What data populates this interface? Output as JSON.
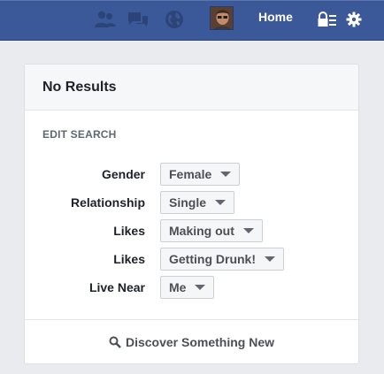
{
  "topbar": {
    "home_label": "Home",
    "icons": [
      "friend-requests-icon",
      "messages-icon",
      "notifications-globe-icon",
      "privacy-shortcuts-icon",
      "settings-gear-icon"
    ]
  },
  "card": {
    "title": "No Results",
    "section_label": "EDIT SEARCH",
    "filters": [
      {
        "label": "Gender",
        "value": "Female"
      },
      {
        "label": "Relationship",
        "value": "Single"
      },
      {
        "label": "Likes",
        "value": "Making out"
      },
      {
        "label": "Likes",
        "value": "Getting Drunk!"
      },
      {
        "label": "Live Near",
        "value": "Me"
      }
    ],
    "footer_link": "Discover Something New"
  },
  "colors": {
    "topbar": "#3b5998",
    "page_bg": "#e9ebee"
  }
}
